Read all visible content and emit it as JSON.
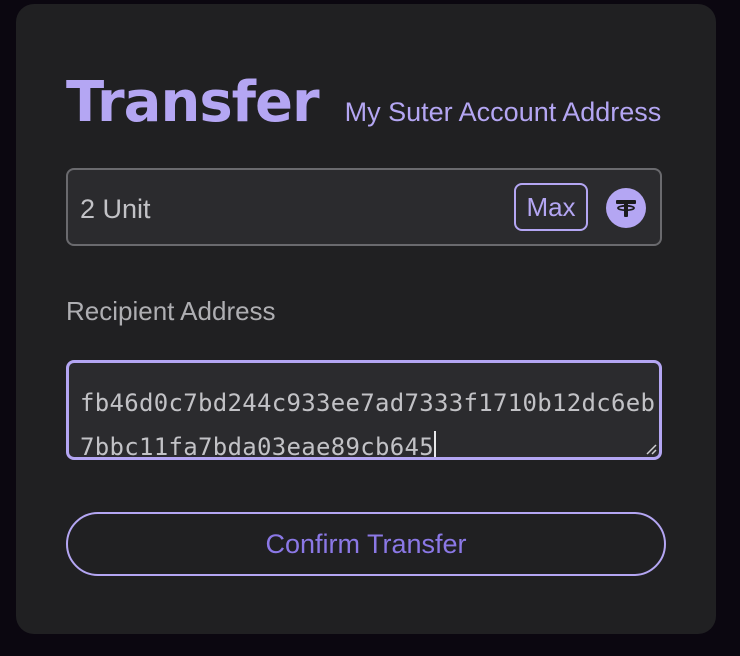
{
  "transfer": {
    "title": "Transfer",
    "subtitle": "My Suter Account Address"
  },
  "amount": {
    "value": "2 Unit",
    "max_label": "Max",
    "token_icon": "tether-icon"
  },
  "recipient": {
    "label": "Recipient Address",
    "value": "fb46d0c7bd244c933ee7ad7333f1710b12dc6eb7bbc11fa7bda03eae89cb645"
  },
  "actions": {
    "confirm_label": "Confirm Transfer"
  },
  "colors": {
    "accent": "#b4a6f3",
    "button_text": "#8b78e6",
    "card_bg": "#202022",
    "page_bg": "#0b0710"
  }
}
